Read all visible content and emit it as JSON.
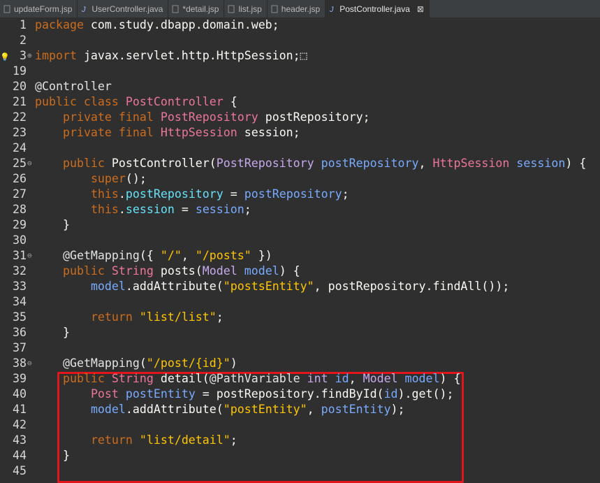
{
  "tabs": [
    {
      "label": "updateForm.jsp",
      "active": false,
      "icon": "jsp-file-icon"
    },
    {
      "label": "UserController.java",
      "active": false,
      "icon": "java-file-icon"
    },
    {
      "label": "*detail.jsp",
      "active": false,
      "icon": "jsp-file-icon"
    },
    {
      "label": "list.jsp",
      "active": false,
      "icon": "jsp-file-icon"
    },
    {
      "label": "header.jsp",
      "active": false,
      "icon": "jsp-file-icon"
    },
    {
      "label": "PostController.java",
      "active": true,
      "icon": "java-file-icon",
      "close": "⊠"
    }
  ],
  "lines": [
    {
      "n": "1",
      "segs": [
        [
          "k",
          "package"
        ],
        [
          "w",
          " com.study.dbapp.domain.web;"
        ]
      ]
    },
    {
      "n": "2",
      "segs": []
    },
    {
      "n": "3",
      "fold": "⊕",
      "bulb": true,
      "segs": [
        [
          "k",
          "import"
        ],
        [
          "w",
          " javax.servlet.http.HttpSession;"
        ],
        [
          "w",
          "⬚"
        ]
      ]
    },
    {
      "n": "19",
      "segs": []
    },
    {
      "n": "20",
      "segs": [
        [
          "a",
          "@Controller"
        ]
      ]
    },
    {
      "n": "21",
      "segs": [
        [
          "k",
          "public class "
        ],
        [
          "t",
          "PostController"
        ],
        [
          "w",
          " {"
        ]
      ]
    },
    {
      "n": "22",
      "segs": [
        [
          "w",
          "    "
        ],
        [
          "k",
          "private final "
        ],
        [
          "t",
          "PostRepository"
        ],
        [
          "w",
          " postRepository;"
        ]
      ]
    },
    {
      "n": "23",
      "segs": [
        [
          "w",
          "    "
        ],
        [
          "k",
          "private final "
        ],
        [
          "t",
          "HttpSession"
        ],
        [
          "w",
          " session;"
        ]
      ]
    },
    {
      "n": "24",
      "segs": []
    },
    {
      "n": "25",
      "fold": "⊖",
      "segs": [
        [
          "w",
          "    "
        ],
        [
          "k",
          "public "
        ],
        [
          "w",
          "PostController("
        ],
        [
          "k2",
          "PostRepository"
        ],
        [
          "w",
          " "
        ],
        [
          "p",
          "postRepository"
        ],
        [
          "w",
          ", "
        ],
        [
          "t",
          "HttpSession"
        ],
        [
          "w",
          " "
        ],
        [
          "p",
          "session"
        ],
        [
          "w",
          ") {"
        ]
      ]
    },
    {
      "n": "26",
      "segs": [
        [
          "w",
          "        "
        ],
        [
          "k",
          "super"
        ],
        [
          "w",
          "();"
        ]
      ]
    },
    {
      "n": "27",
      "segs": [
        [
          "w",
          "        "
        ],
        [
          "k",
          "this"
        ],
        [
          "w",
          "."
        ],
        [
          "f",
          "postRepository"
        ],
        [
          "w",
          " = "
        ],
        [
          "p",
          "postRepository"
        ],
        [
          "w",
          ";"
        ]
      ]
    },
    {
      "n": "28",
      "segs": [
        [
          "w",
          "        "
        ],
        [
          "k",
          "this"
        ],
        [
          "w",
          "."
        ],
        [
          "f",
          "session"
        ],
        [
          "w",
          " = "
        ],
        [
          "p",
          "session"
        ],
        [
          "w",
          ";"
        ]
      ]
    },
    {
      "n": "29",
      "segs": [
        [
          "w",
          "    }"
        ]
      ]
    },
    {
      "n": "30",
      "segs": []
    },
    {
      "n": "31",
      "fold": "⊖",
      "segs": [
        [
          "w",
          "    "
        ],
        [
          "a",
          "@GetMapping"
        ],
        [
          "w",
          "({ "
        ],
        [
          "s",
          "\"/\""
        ],
        [
          "w",
          ", "
        ],
        [
          "s",
          "\"/posts\""
        ],
        [
          "w",
          " })"
        ]
      ]
    },
    {
      "n": "32",
      "segs": [
        [
          "w",
          "    "
        ],
        [
          "k",
          "public "
        ],
        [
          "t",
          "String"
        ],
        [
          "w",
          " posts("
        ],
        [
          "k2",
          "Model"
        ],
        [
          "w",
          " "
        ],
        [
          "p",
          "model"
        ],
        [
          "w",
          ") {"
        ]
      ]
    },
    {
      "n": "33",
      "segs": [
        [
          "w",
          "        "
        ],
        [
          "p",
          "model"
        ],
        [
          "w",
          ".addAttribute("
        ],
        [
          "s",
          "\"postsEntity\""
        ],
        [
          "w",
          ", postRepository.findAll());"
        ]
      ]
    },
    {
      "n": "34",
      "segs": []
    },
    {
      "n": "35",
      "segs": [
        [
          "w",
          "        "
        ],
        [
          "k",
          "return "
        ],
        [
          "s",
          "\"list/list\""
        ],
        [
          "w",
          ";"
        ]
      ]
    },
    {
      "n": "36",
      "segs": [
        [
          "w",
          "    }"
        ]
      ]
    },
    {
      "n": "37",
      "segs": []
    },
    {
      "n": "38",
      "fold": "⊖",
      "segs": [
        [
          "w",
          "    "
        ],
        [
          "a",
          "@GetMapping"
        ],
        [
          "w",
          "("
        ],
        [
          "s",
          "\"/post/{id}\""
        ],
        [
          "w",
          ")"
        ]
      ]
    },
    {
      "n": "39",
      "segs": [
        [
          "w",
          "    "
        ],
        [
          "k",
          "public "
        ],
        [
          "t",
          "String"
        ],
        [
          "w",
          " detail("
        ],
        [
          "a",
          "@PathVariable"
        ],
        [
          "w",
          " "
        ],
        [
          "k2",
          "int"
        ],
        [
          "w",
          " "
        ],
        [
          "p",
          "id"
        ],
        [
          "w",
          ", "
        ],
        [
          "k2",
          "Model"
        ],
        [
          "w",
          " "
        ],
        [
          "p",
          "model"
        ],
        [
          "w",
          ") {"
        ]
      ]
    },
    {
      "n": "40",
      "segs": [
        [
          "w",
          "        "
        ],
        [
          "t",
          "Post"
        ],
        [
          "w",
          " "
        ],
        [
          "p",
          "postEntity"
        ],
        [
          "w",
          " = postRepository.findById("
        ],
        [
          "p",
          "id"
        ],
        [
          "w",
          ").get();"
        ]
      ]
    },
    {
      "n": "41",
      "segs": [
        [
          "w",
          "        "
        ],
        [
          "p",
          "model"
        ],
        [
          "w",
          ".addAttribute("
        ],
        [
          "s",
          "\"postEntity\""
        ],
        [
          "w",
          ", "
        ],
        [
          "p",
          "postEntity"
        ],
        [
          "w",
          ");"
        ]
      ]
    },
    {
      "n": "42",
      "segs": []
    },
    {
      "n": "43",
      "segs": [
        [
          "w",
          "        "
        ],
        [
          "k",
          "return "
        ],
        [
          "s",
          "\"list/detail\""
        ],
        [
          "w",
          ";"
        ]
      ]
    },
    {
      "n": "44",
      "segs": [
        [
          "w",
          "    }"
        ]
      ]
    },
    {
      "n": "45",
      "segs": []
    }
  ]
}
